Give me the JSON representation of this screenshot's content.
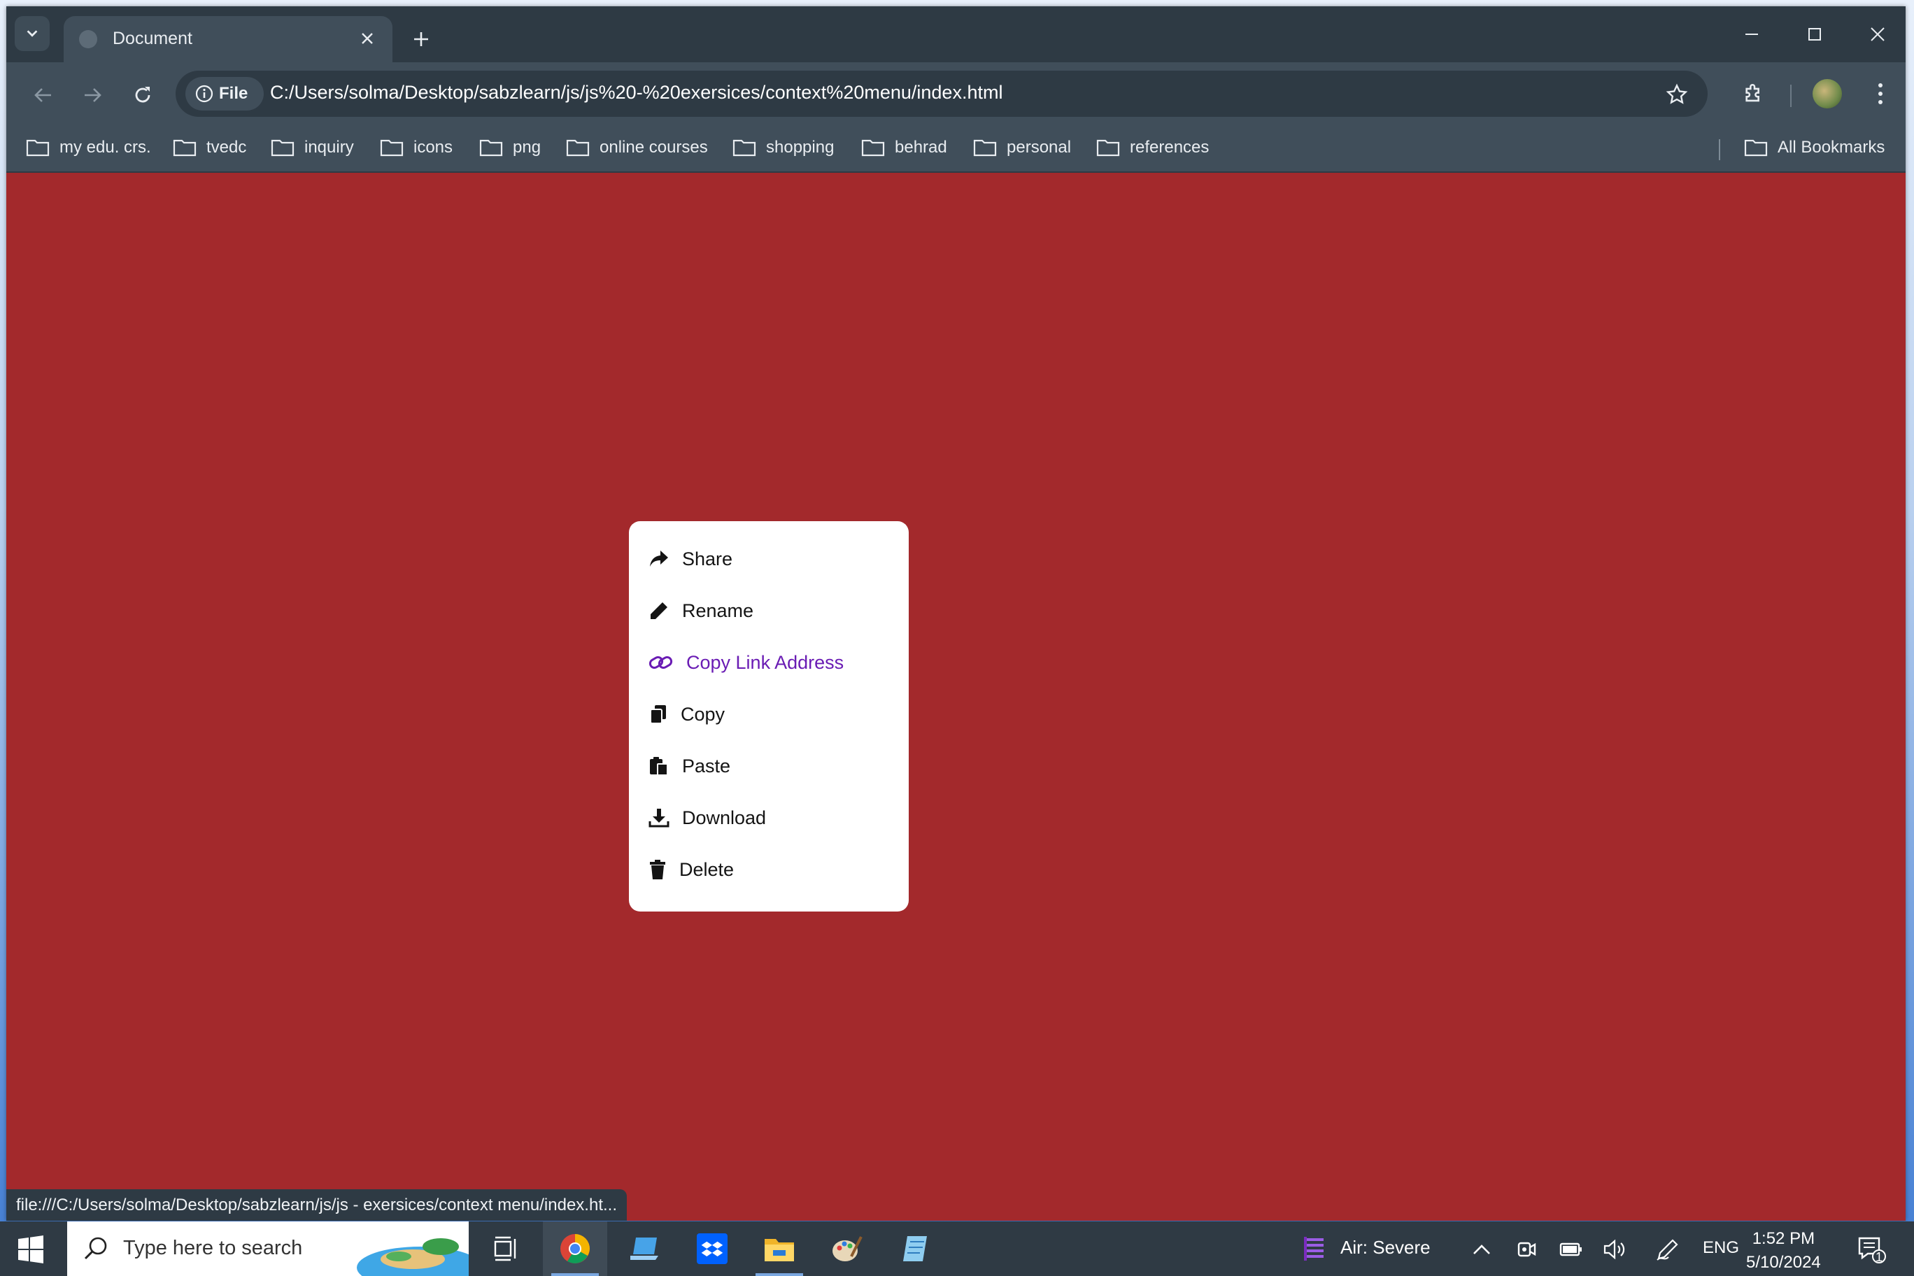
{
  "browser": {
    "tab_title": "Document",
    "address": {
      "chip_label": "File",
      "url": "C:/Users/solma/Desktop/sabzlearn/js/js%20-%20exersices/context%20menu/index.html"
    },
    "bookmarks": [
      "my edu. crs.",
      "tvedc",
      "inquiry",
      "icons",
      "png",
      "online courses",
      "shopping",
      "behrad",
      "personal",
      "references"
    ],
    "all_bookmarks_label": "All Bookmarks",
    "status_url": "file:///C:/Users/solma/Desktop/sabzlearn/js/js - exersices/context menu/index.ht..."
  },
  "page": {
    "background_color": "#a3292c",
    "context_menu": {
      "items": [
        {
          "label": "Share",
          "icon": "share-icon"
        },
        {
          "label": "Rename",
          "icon": "pencil-icon"
        },
        {
          "label": "Copy Link Address",
          "icon": "link-icon",
          "hovered": true
        },
        {
          "label": "Copy",
          "icon": "copy-icon"
        },
        {
          "label": "Paste",
          "icon": "paste-icon"
        },
        {
          "label": "Download",
          "icon": "download-icon"
        },
        {
          "label": "Delete",
          "icon": "trash-icon"
        }
      ],
      "hover_color": "#6a1cb4"
    }
  },
  "taskbar": {
    "search_placeholder": "Type here to search",
    "weather": "Air: Severe",
    "language": "ENG",
    "time": "1:52 PM",
    "date": "5/10/2024",
    "notification_count": "1"
  }
}
